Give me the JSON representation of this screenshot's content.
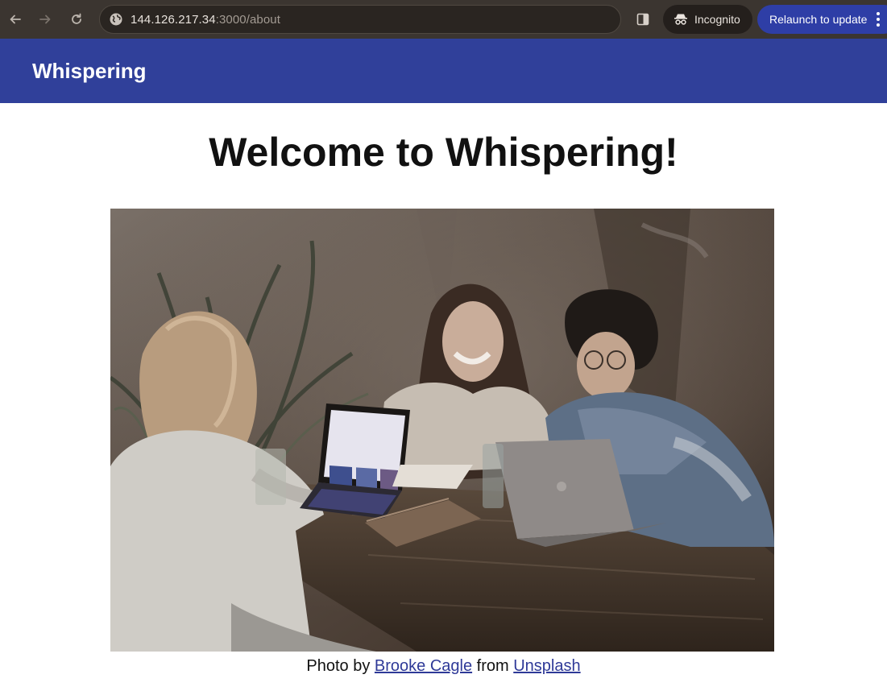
{
  "browser": {
    "url_host": "144.126.217.34",
    "url_path": ":3000/about",
    "incognito_label": "Incognito",
    "relaunch_label": "Relaunch to update"
  },
  "header": {
    "brand": "Whispering"
  },
  "main": {
    "title": "Welcome to Whispering!",
    "photo_alt": "Three people laughing at a café table with laptops",
    "caption": {
      "prefix": "Photo by ",
      "author": "Brooke Cagle",
      "middle": " from ",
      "source": "Unsplash"
    }
  },
  "colors": {
    "chrome_bg": "#3b3530",
    "appbar_bg": "#30409a",
    "relaunch_bg": "#2e3ea6",
    "link": "#2f3a98"
  },
  "icons": [
    "back-arrow-icon",
    "forward-arrow-icon",
    "reload-icon",
    "globe-icon",
    "side-panel-icon",
    "incognito-icon",
    "more-vert-icon"
  ]
}
